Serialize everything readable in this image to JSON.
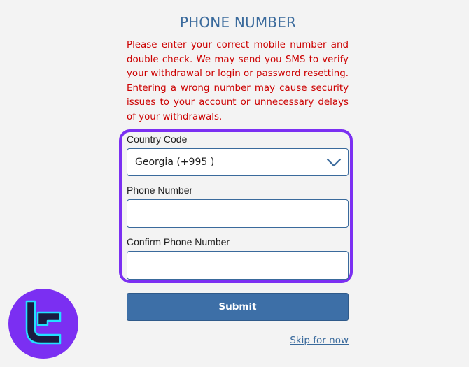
{
  "header": {
    "title": "PHONE NUMBER"
  },
  "notice": {
    "text": "Please enter your correct mobile number and double check. We may send you SMS to verify your withdrawal or login or password resetting. Entering a wrong number may cause security issues to your account or unnecessary delays of your withdrawals."
  },
  "form": {
    "country_code": {
      "label": "Country Code",
      "selected": "Georgia (+995 )"
    },
    "phone_number": {
      "label": "Phone Number",
      "value": ""
    },
    "confirm_phone_number": {
      "label": "Confirm Phone Number",
      "value": ""
    },
    "submit_label": "Submit",
    "skip_label": "Skip for now"
  },
  "colors": {
    "title": "#3a6a9c",
    "warning": "#cc0000",
    "highlight": "#7b2ff2",
    "button": "#3d6fa7",
    "logo_bg": "#7b2ff2",
    "logo_mark": "#22e0ff"
  },
  "icons": {
    "select_arrow": "chevron-down-icon",
    "brand_logo": "brand-logo-icon"
  }
}
